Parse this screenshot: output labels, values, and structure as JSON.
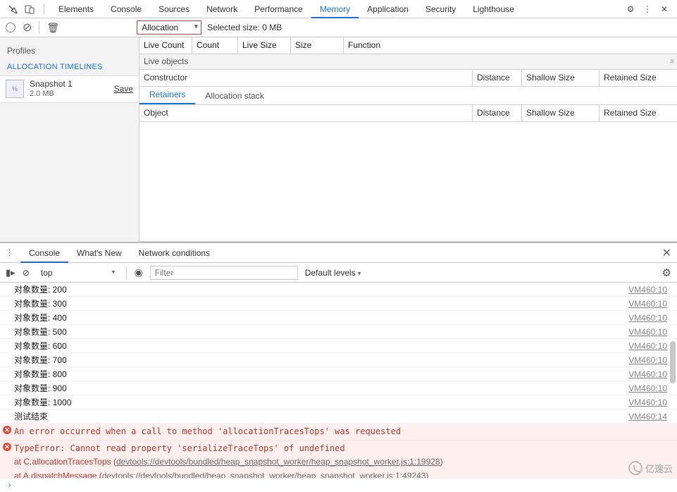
{
  "topTabs": [
    "Elements",
    "Console",
    "Sources",
    "Network",
    "Performance",
    "Memory",
    "Application",
    "Security",
    "Lighthouse"
  ],
  "activeTopTab": "Memory",
  "toolbar": {
    "selectValue": "Allocation",
    "selectedSize": "Selected size: 0 MB"
  },
  "sidebar": {
    "profiles": "Profiles",
    "section": "ALLOCATION TIMELINES",
    "snapshot": {
      "title": "Snapshot 1",
      "size": "2.0 MB",
      "save": "Save"
    }
  },
  "cols1": {
    "liveCount": "Live Count",
    "count": "Count",
    "liveSize": "Live Size",
    "size": "Size",
    "func": "Function"
  },
  "liveObjects": "Live objects",
  "cols2": {
    "constructor": "Constructor",
    "distance": "Distance",
    "shallow": "Shallow Size",
    "retained": "Retained Size"
  },
  "subtabs": {
    "retainers": "Retainers",
    "allocStack": "Allocation stack",
    "active": "Retainers"
  },
  "cols3": {
    "object": "Object",
    "distance": "Distance",
    "shallow": "Shallow Size",
    "retained": "Retained Size"
  },
  "drawerTabs": [
    "Console",
    "What's New",
    "Network conditions"
  ],
  "activeDrawerTab": "Console",
  "consoleToolbar": {
    "context": "top",
    "filterPlaceholder": "Filter",
    "levels": "Default levels"
  },
  "logs": [
    {
      "msg": "对象数量: 200",
      "src": "VM460:10"
    },
    {
      "msg": "对象数量: 300",
      "src": "VM460:10"
    },
    {
      "msg": "对象数量: 400",
      "src": "VM460:10"
    },
    {
      "msg": "对象数量: 500",
      "src": "VM460:10"
    },
    {
      "msg": "对象数量: 600",
      "src": "VM460:10"
    },
    {
      "msg": "对象数量: 700",
      "src": "VM460:10"
    },
    {
      "msg": "对象数量: 800",
      "src": "VM460:10"
    },
    {
      "msg": "对象数量: 900",
      "src": "VM460:10"
    },
    {
      "msg": "对象数量: 1000",
      "src": "VM460:10"
    },
    {
      "msg": "测试结束",
      "src": "VM460:14"
    }
  ],
  "errors": [
    {
      "text": "An error occurred when a call to method 'allocationTracesTops' was requested"
    },
    {
      "text": "TypeError: Cannot read property 'serializeTraceTops' of undefined",
      "stack": [
        {
          "pre": "    at C.allocationTracesTops (",
          "link": "devtools://devtools/bundled/heap_snapshot_worker/heap_snapshot_worker.js:1:19928",
          "post": ")"
        },
        {
          "pre": "    at A.dispatchMessage (",
          "link": "devtools://devtools/bundled/heap_snapshot_worker/heap_snapshot_worker.js:1:49243",
          "post": ")"
        }
      ]
    }
  ],
  "watermark": "亿速云"
}
